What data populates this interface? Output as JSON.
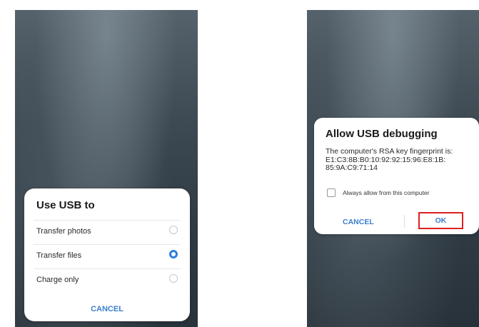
{
  "usb_sheet": {
    "title": "Use USB to",
    "options": [
      {
        "label": "Transfer photos",
        "selected": false
      },
      {
        "label": "Transfer files",
        "selected": true
      },
      {
        "label": "Charge only",
        "selected": false
      }
    ],
    "cancel_label": "CANCEL"
  },
  "debug_dialog": {
    "title": "Allow USB debugging",
    "message_lines": [
      "The computer's RSA key fingerprint is:",
      "E1:C3:8B:B0:10:92:92:15:96:E8:1B:",
      "85:9A:C9:71:14"
    ],
    "checkbox_label": "Always allow from this computer",
    "checkbox_checked": false,
    "cancel_label": "CANCEL",
    "ok_label": "OK"
  },
  "colors": {
    "accent": "#2f7fd8",
    "highlight_box": "#e02020",
    "wallpaper": "#3e4a53"
  }
}
